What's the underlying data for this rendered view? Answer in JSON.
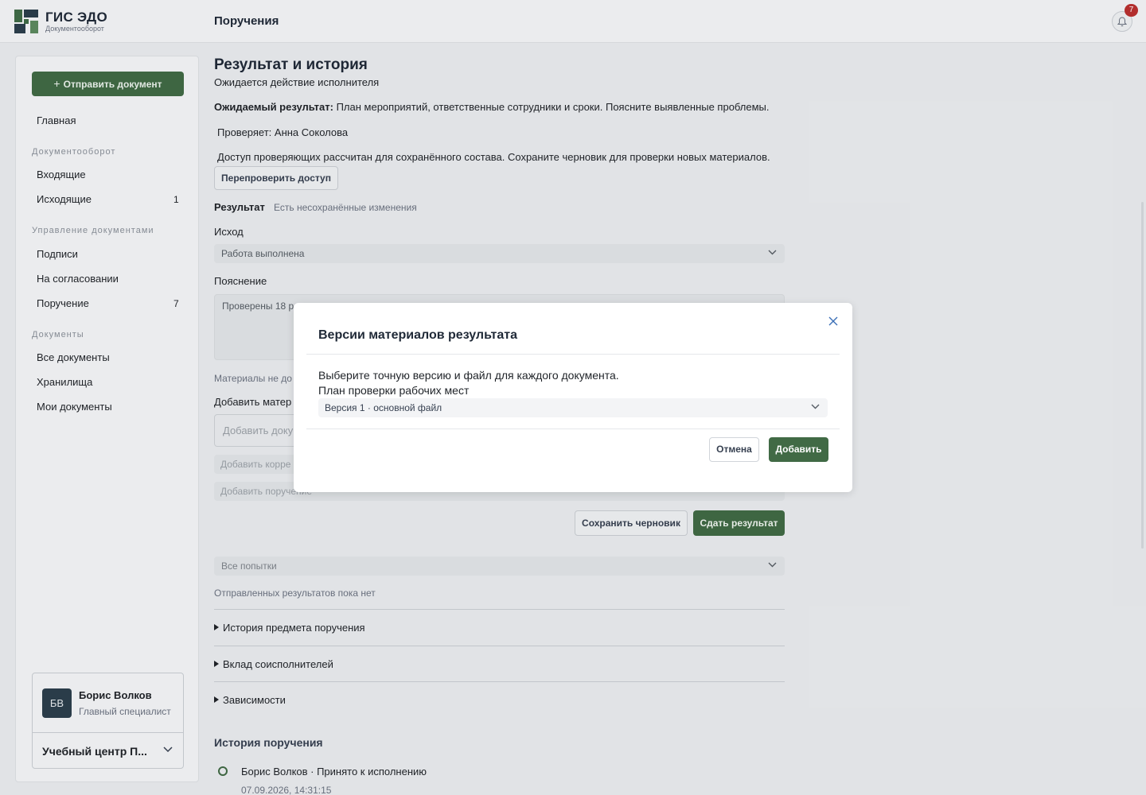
{
  "brand": {
    "name": "ГИС ЭДО",
    "subtitle": "Документооборот"
  },
  "header": {
    "title": "Поручения",
    "notifications_count": "7"
  },
  "sidebar": {
    "send_button": "Отправить документ",
    "home": "Главная",
    "sections": [
      {
        "title": "Документооборот",
        "items": [
          {
            "label": "Входящие",
            "count": ""
          },
          {
            "label": "Исходящие",
            "count": "1"
          }
        ]
      },
      {
        "title": "Управление документами",
        "items": [
          {
            "label": "Подписи",
            "count": ""
          },
          {
            "label": "На согласовании",
            "count": ""
          },
          {
            "label": "Поручение",
            "count": "7"
          }
        ]
      },
      {
        "title": "Документы",
        "items": [
          {
            "label": "Все документы",
            "count": ""
          },
          {
            "label": "Хранилища",
            "count": ""
          },
          {
            "label": "Мои документы",
            "count": ""
          }
        ]
      }
    ],
    "user": {
      "initials": "БВ",
      "name": "Борис Волков",
      "role": "Главный специалист",
      "org": "Учебный центр П..."
    }
  },
  "main": {
    "title": "Результат и история",
    "status": "Ожидается действие исполнителя",
    "expected_label": "Ожидаемый результат:",
    "expected_text": "План мероприятий, ответственные сотрудники и сроки. Поясните выявленные проблемы.",
    "reviewer": "Проверяет: Анна Соколова",
    "access_note": "Доступ проверяющих рассчитан для сохранённого состава. Сохраните черновик для проверки новых материалов.",
    "recheck_button": "Перепроверить доступ",
    "result_label": "Результат",
    "unsaved_note": "Есть несохранённые изменения",
    "outcome_label": "Исход",
    "outcome_value": "Работа выполнена",
    "explanation_label": "Пояснение",
    "explanation_value": "Проверены 18 р",
    "materials_note": "Материалы не до",
    "add_materials_label": "Добавить матер",
    "add_doc_placeholder": "Добавить доку",
    "add_corr_placeholder": "Добавить корре",
    "add_task_placeholder": "Добавить поручение",
    "save_draft_button": "Сохранить черновик",
    "submit_button": "Сдать результат",
    "attempts_select": "Все попытки",
    "no_results": "Отправленных результатов пока нет",
    "accordions": [
      "История предмета поручения",
      "Вклад соисполнителей",
      "Зависимости"
    ],
    "history_title": "История поручения",
    "history_entry": {
      "text": "Борис Волков · Принято к исполнению",
      "time": "07.09.2026, 14:31:15"
    }
  },
  "modal": {
    "title": "Версии материалов результата",
    "instruction": "Выберите точную версию и файл для каждого документа.",
    "document_name": "План проверки рабочих мест",
    "version_select": "Версия 1 · основной файл",
    "cancel_button": "Отмена",
    "add_button": "Добавить"
  },
  "colors": {
    "accent": "#416a45",
    "badge": "#b8302f",
    "avatar": "#2c3e4c"
  }
}
